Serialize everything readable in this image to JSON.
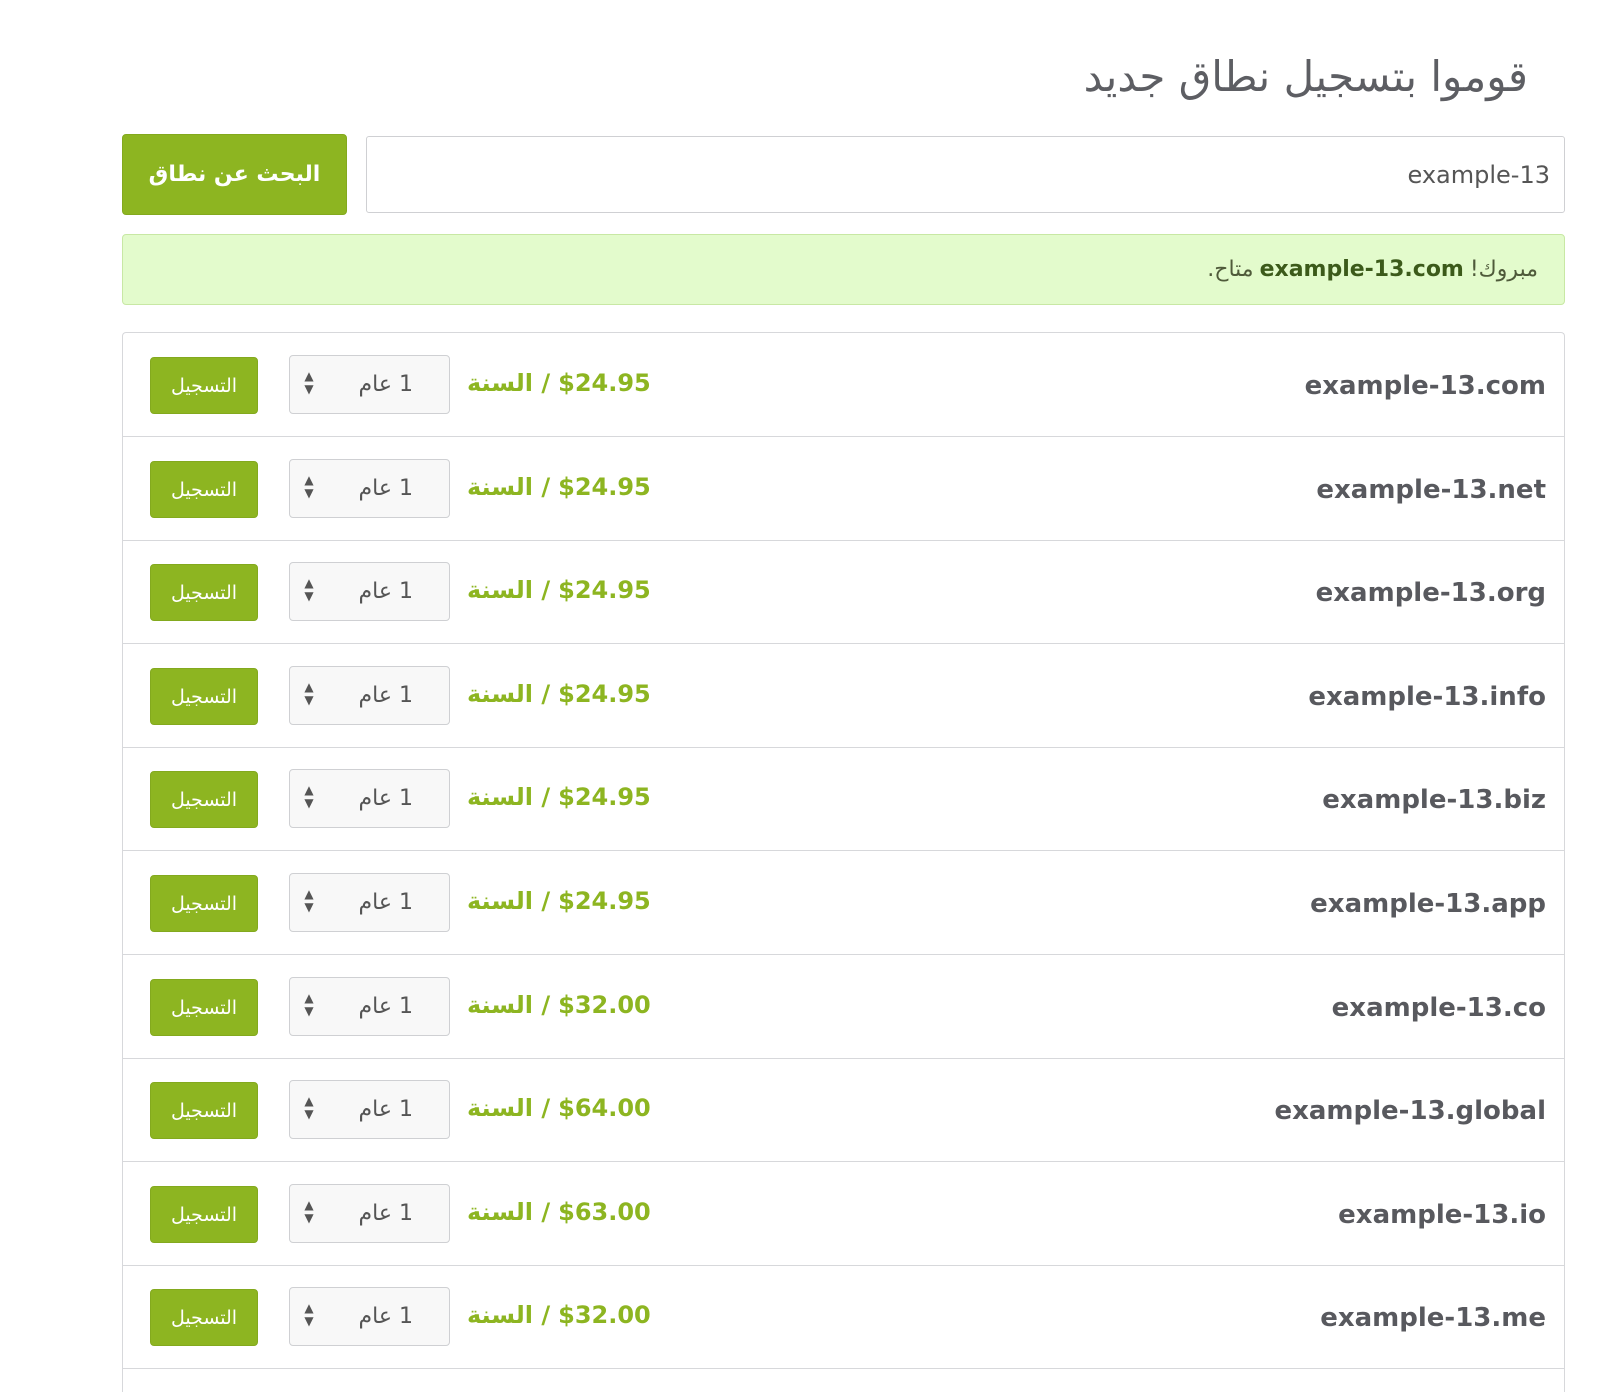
{
  "page": {
    "title": "قوموا بتسجيل نطاق جديد"
  },
  "search": {
    "value": "example-13",
    "button_label": "البحث عن نطاق"
  },
  "alert": {
    "prefix": "مبروك!",
    "domain": "example-13.com",
    "suffix": "متاح."
  },
  "colors": {
    "accent": "#8db521",
    "alert_bg": "#e3fbcc",
    "text": "#58595e"
  },
  "results": [
    {
      "domain": "example-13.com",
      "price": "$24.95",
      "period_unit": "/ السنة",
      "term": "1 عام",
      "button": "التسجيل"
    },
    {
      "domain": "example-13.net",
      "price": "$24.95",
      "period_unit": "/ السنة",
      "term": "1 عام",
      "button": "التسجيل"
    },
    {
      "domain": "example-13.org",
      "price": "$24.95",
      "period_unit": "/ السنة",
      "term": "1 عام",
      "button": "التسجيل"
    },
    {
      "domain": "example-13.info",
      "price": "$24.95",
      "period_unit": "/ السنة",
      "term": "1 عام",
      "button": "التسجيل"
    },
    {
      "domain": "example-13.biz",
      "price": "$24.95",
      "period_unit": "/ السنة",
      "term": "1 عام",
      "button": "التسجيل"
    },
    {
      "domain": "example-13.app",
      "price": "$24.95",
      "period_unit": "/ السنة",
      "term": "1 عام",
      "button": "التسجيل"
    },
    {
      "domain": "example-13.co",
      "price": "$32.00",
      "period_unit": "/ السنة",
      "term": "1 عام",
      "button": "التسجيل"
    },
    {
      "domain": "example-13.global",
      "price": "$64.00",
      "period_unit": "/ السنة",
      "term": "1 عام",
      "button": "التسجيل"
    },
    {
      "domain": "example-13.io",
      "price": "$63.00",
      "period_unit": "/ السنة",
      "term": "1 عام",
      "button": "التسجيل"
    },
    {
      "domain": "example-13.me",
      "price": "$32.00",
      "period_unit": "/ السنة",
      "term": "1 عام",
      "button": "التسجيل"
    }
  ]
}
